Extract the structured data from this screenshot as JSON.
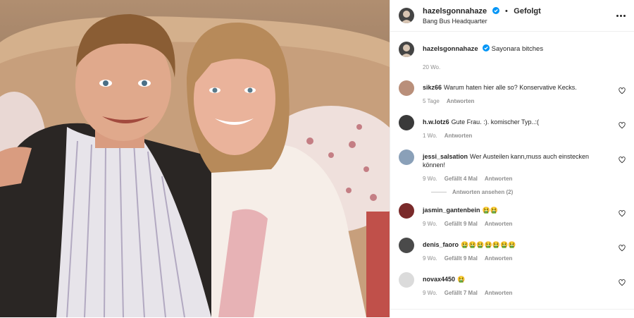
{
  "post": {
    "username": "hazelsgonnahaze",
    "follow_label": "Gefolgt",
    "location": "Bang Bus Headquarter",
    "caption": "Sayonara bitches",
    "caption_time": "20 Wo."
  },
  "comments": [
    {
      "user": "sikz66",
      "text": "Warum haten hier alle so? Konservative Kecks.",
      "time": "5 Tage",
      "likes": "",
      "reply": "Antworten",
      "avatar_color": "#b98f7a"
    },
    {
      "user": "h.w.lotz6",
      "text": "Gute Frau. :). komischer Typ..:(",
      "time": "1 Wo.",
      "likes": "",
      "reply": "Antworten",
      "avatar_color": "#3a3a3a"
    },
    {
      "user": "jessi_salsation",
      "text": "Wer Austeilen kann,muss auch einstecken können!",
      "time": "9 Wo.",
      "likes": "Gefällt 4 Mal",
      "reply": "Antworten",
      "avatar_color": "#8aa0b8"
    },
    {
      "user": "jasmin_gantenbein",
      "text": "🤮🤮",
      "time": "9 Wo.",
      "likes": "Gefällt 9 Mal",
      "reply": "Antworten",
      "avatar_color": "#7a2a2a"
    },
    {
      "user": "denis_faoro",
      "text": "🤮🤮🤮🤮🤮🤮🤮",
      "time": "9 Wo.",
      "likes": "Gefällt 9 Mal",
      "reply": "Antworten",
      "avatar_color": "#4a4a4a"
    },
    {
      "user": "novax4450",
      "text": "🤮",
      "time": "9 Wo.",
      "likes": "Gefällt 7 Mal",
      "reply": "Antworten",
      "avatar_color": "#dbdbdb"
    }
  ],
  "thread_label": "Antworten ansehen (2)",
  "colors": {
    "accent": "#0095f6",
    "muted": "#8e8e8e",
    "text": "#262626"
  },
  "icons": [
    "verified-badge-icon",
    "more-options-icon",
    "heart-icon"
  ]
}
